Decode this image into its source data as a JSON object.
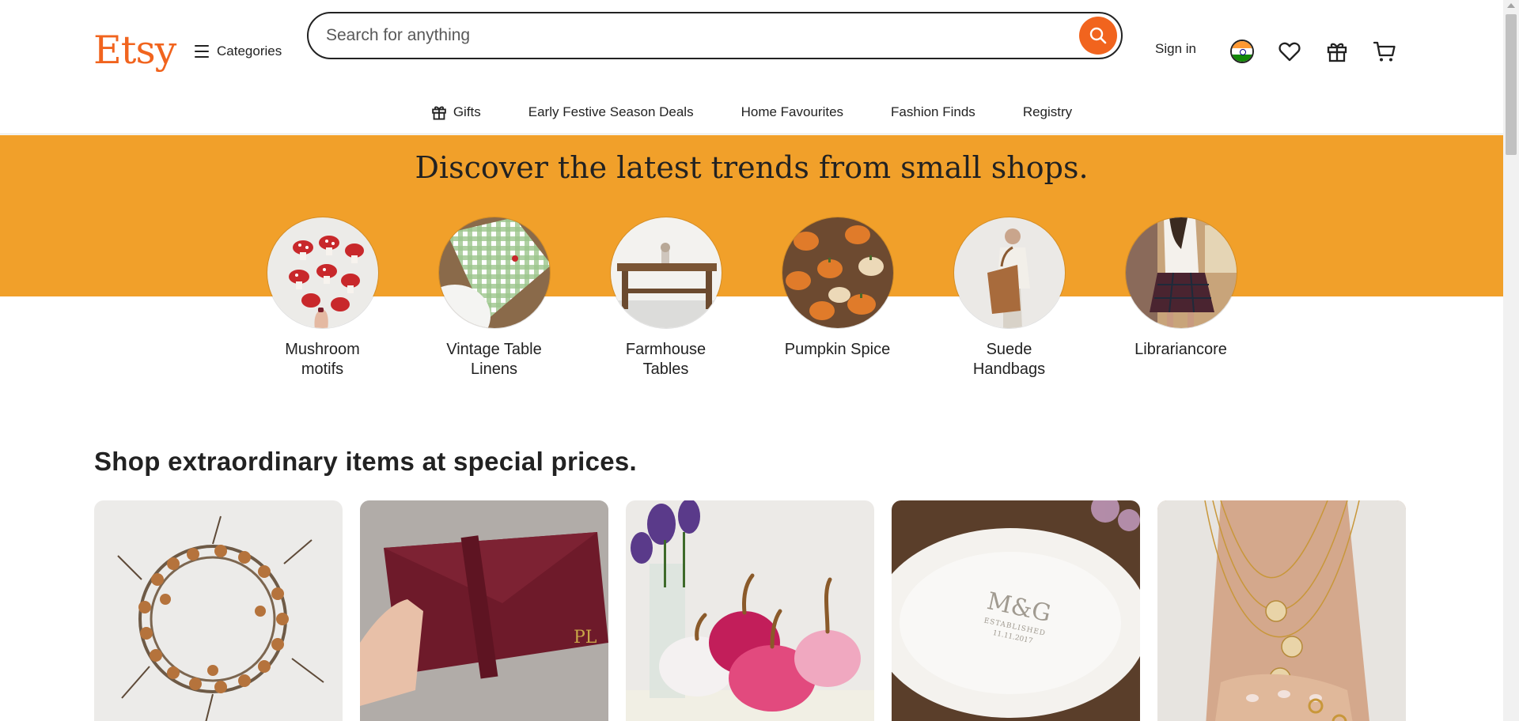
{
  "header": {
    "logo": "Etsy",
    "categories_label": "Categories",
    "search_placeholder": "Search for anything",
    "signin_label": "Sign in"
  },
  "nav": {
    "items": [
      {
        "label": "Gifts",
        "icon": "gift-icon"
      },
      {
        "label": "Early Festive Season Deals"
      },
      {
        "label": "Home Favourites"
      },
      {
        "label": "Fashion Finds"
      },
      {
        "label": "Registry"
      }
    ]
  },
  "hero": {
    "title": "Discover the latest trends from small shops.",
    "trends": [
      {
        "label": "Mushroom motifs"
      },
      {
        "label": "Vintage Table Linens"
      },
      {
        "label": "Farmhouse Tables"
      },
      {
        "label": "Pumpkin Spice"
      },
      {
        "label": "Suede Handbags"
      },
      {
        "label": "Librariancore"
      }
    ]
  },
  "deals": {
    "title": "Shop extraordinary items at special prices.",
    "items": [
      {
        "image": "berry-wreath"
      },
      {
        "image": "leather-clutch",
        "monogram": "PL"
      },
      {
        "image": "velvet-pumpkins"
      },
      {
        "image": "ceramic-platter",
        "monogram": "M&G",
        "engraving_line1": "ESTABLISHED",
        "engraving_line2": "11.11.2017"
      },
      {
        "image": "coin-necklaces"
      }
    ]
  },
  "colors": {
    "brand": "#f1641e",
    "hero_band": "#f1a02a"
  }
}
